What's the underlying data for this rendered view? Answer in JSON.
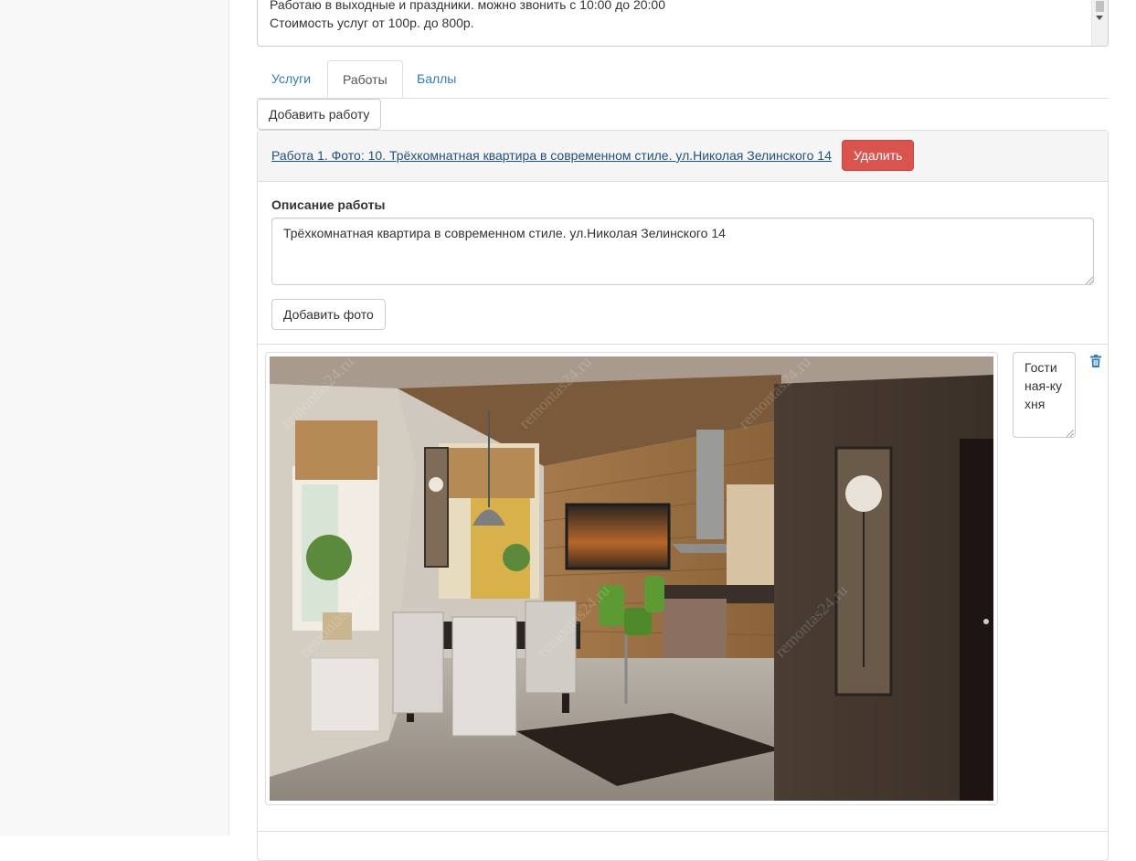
{
  "profile": {
    "bio_lines": [
      "Работаю в выходные и праздники. можно звонить с 10:00 до 20:00",
      "Стоимость услуг от 100р. до 800р."
    ]
  },
  "tabs": [
    {
      "label": "Услуги",
      "active": false
    },
    {
      "label": "Работы",
      "active": true
    },
    {
      "label": "Баллы",
      "active": false
    }
  ],
  "actions": {
    "add_work": "Добавить работу"
  },
  "work": {
    "title_link": "Работа 1. Фото: 10. Трёхкомнатная квартира в современном стиле. ул.Николая Зелинского 14",
    "delete_label": "Удалить",
    "description_label": "Описание работы",
    "description_value": "Трёхкомнатная квартира в современном стиле. ул.Николая Зелинского 14",
    "add_photo_label": "Добавить фото",
    "photo": {
      "caption": "Гостиная-кухня",
      "watermark": "remontas24.ru"
    }
  },
  "colors": {
    "link": "#337ab7",
    "danger": "#d9534f",
    "trash_icon": "#337ab7"
  }
}
